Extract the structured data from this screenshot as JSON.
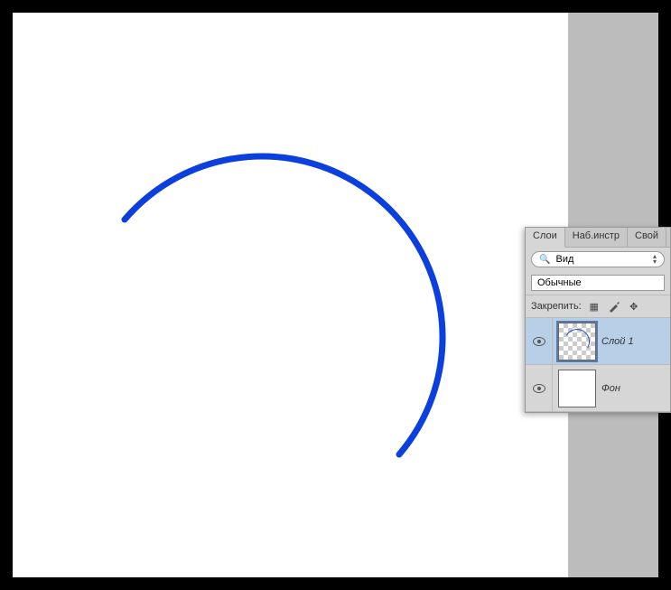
{
  "panel": {
    "tabs": {
      "layers": "Слои",
      "tools": "Наб.инстр",
      "props": "Свой"
    },
    "filter": {
      "label": "Вид"
    },
    "blend": {
      "mode": "Обычные"
    },
    "lock": {
      "label": "Закрепить:"
    },
    "layers": [
      {
        "name": "Слой 1"
      },
      {
        "name": "Фон"
      }
    ]
  }
}
